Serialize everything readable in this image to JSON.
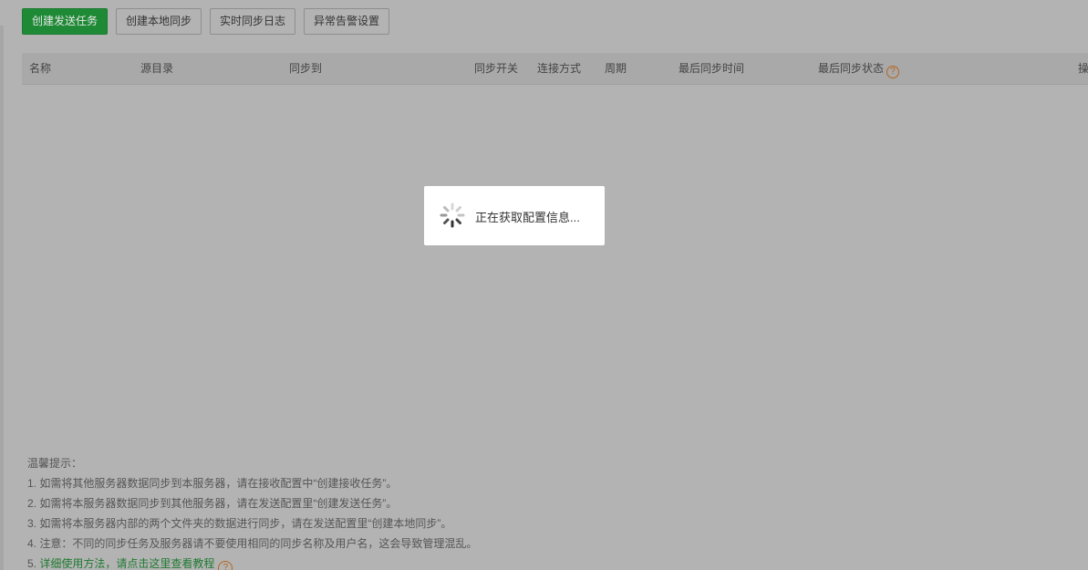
{
  "toolbar": {
    "create_send_task": "创建发送任务",
    "create_local_sync": "创建本地同步",
    "realtime_sync_log": "实时同步日志",
    "alert_settings": "异常告警设置"
  },
  "table": {
    "columns": [
      "名称",
      "源目录",
      "同步到",
      "同步开关",
      "连接方式",
      "周期",
      "最后同步时间",
      "最后同步状态",
      "操"
    ]
  },
  "loading": {
    "text": "正在获取配置信息..."
  },
  "tips": {
    "title": "温馨提示：",
    "lines": [
      "1. 如需将其他服务器数据同步到本服务器，请在接收配置中“创建接收任务”。",
      "2. 如需将本服务器数据同步到其他服务器，请在发送配置里“创建发送任务”。",
      "3. 如需将本服务器内部的两个文件夹的数据进行同步，请在发送配置里“创建本地同步”。",
      "4. 注意：不同的同步任务及服务器请不要使用相同的同步名称及用户名，这会导致管理混乱。"
    ],
    "line5_prefix": "5. ",
    "line5_link": "详细使用方法，请点击这里查看教程"
  },
  "icons": {
    "help": "?"
  },
  "colors": {
    "primary": "#1f8a36",
    "help_icon": "#b5651d",
    "link": "#1f7a30"
  }
}
